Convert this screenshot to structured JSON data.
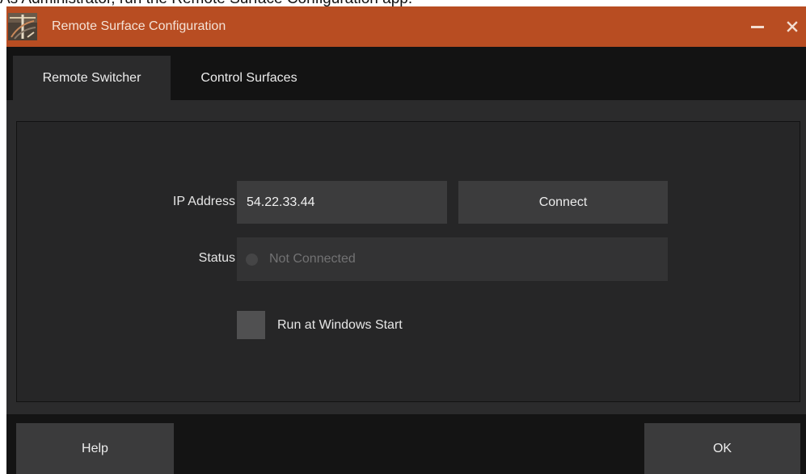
{
  "caption": "As Administrator, run the Remote Surface Configuration app.",
  "window": {
    "title": "Remote Surface Configuration",
    "accent_color": "#b84d22"
  },
  "tabs": [
    {
      "label": "Remote Switcher",
      "active": true
    },
    {
      "label": "Control Surfaces",
      "active": false
    }
  ],
  "form": {
    "ip_label": "IP Address",
    "ip_value": "54.22.33.44",
    "connect_label": "Connect",
    "status_label": "Status",
    "status_value": "Not Connected",
    "run_at_start_label": "Run at Windows Start",
    "run_at_start_checked": false
  },
  "footer": {
    "help_label": "Help",
    "ok_label": "OK"
  },
  "icons": {
    "app": "app-logo-icon",
    "minimize": "minimize-icon",
    "close": "close-icon",
    "status": "status-indicator-icon"
  }
}
